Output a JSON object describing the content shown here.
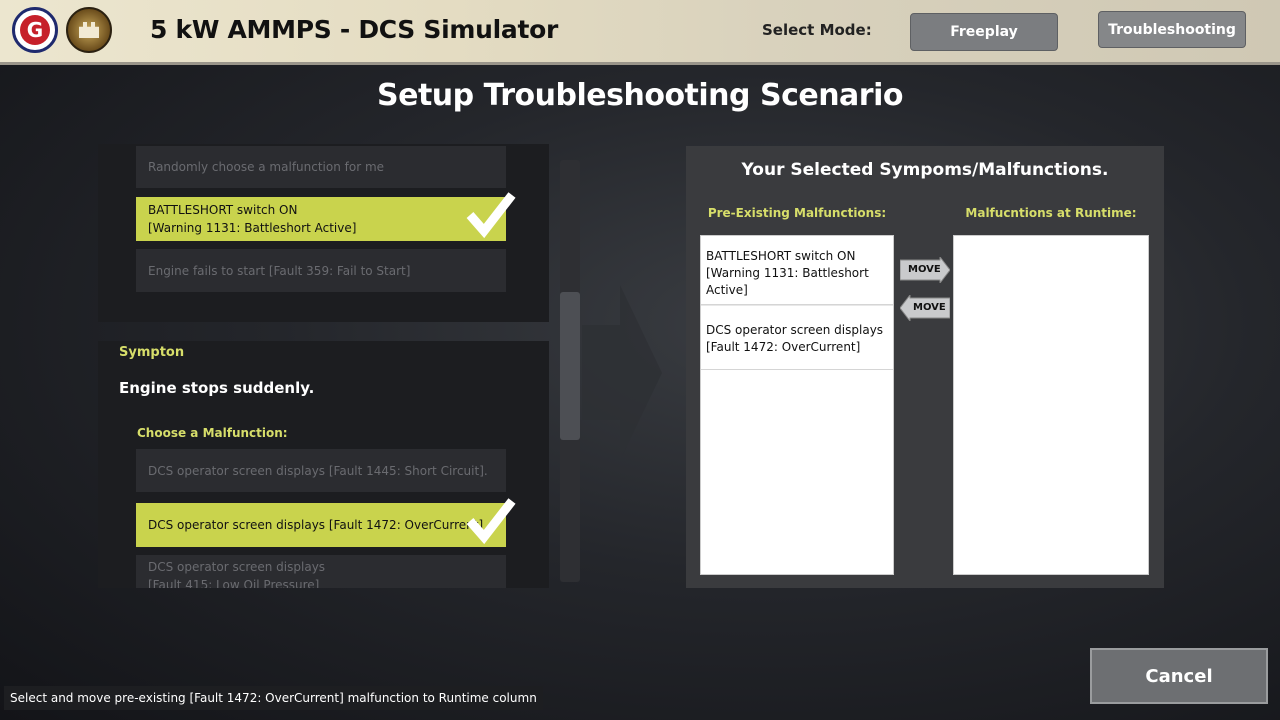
{
  "header": {
    "title": "5 kW AMMPS - DCS Simulator",
    "logo_left": {
      "glyph": "G",
      "icon": "g-emblem-logo",
      "color": "#c6202a"
    },
    "logo_right": {
      "icon": "castle-emblem-logo"
    },
    "select_mode_label": "Select Mode:",
    "modes": [
      {
        "label": "Freeplay",
        "active": false
      },
      {
        "label": "Troubleshooting",
        "active": true
      }
    ]
  },
  "page_title": "Setup Troubleshooting Scenario",
  "top_options": [
    {
      "text": "Randomly choose a malfunction for me",
      "selected": false
    },
    {
      "text": "BATTLESHORT switch ON\n[Warning 1131: Battleshort Active]",
      "line1": "BATTLESHORT switch ON",
      "line2": "[Warning 1131: Battleshort Active]",
      "selected": true
    },
    {
      "text": "Engine fails to start [Fault 359: Fail to Start]",
      "selected": false
    }
  ],
  "symptom": {
    "label": "Sympton",
    "text": "Engine stops suddenly.",
    "choose_label": "Choose a Malfunction:",
    "options": [
      {
        "text": "DCS operator screen displays [Fault 1445: Short Circuit].",
        "selected": false
      },
      {
        "text": "DCS operator screen displays [Fault 1472: OverCurrent]",
        "selected": true
      },
      {
        "line1": "DCS operator screen displays",
        "line2": "[Fault 415: Low Oil Pressure]",
        "selected": false
      }
    ]
  },
  "selected_panel": {
    "title": "Your Selected Sympoms/Malfunctions.",
    "pre_existing_label": "Pre-Existing Malfunctions:",
    "runtime_label": "Malfucntions at Runtime:",
    "pre_existing_items": [
      {
        "line1": "BATTLESHORT switch ON",
        "line2": "[Warning 1131: Battleshort",
        "line3": "Active]"
      },
      {
        "line1": "DCS operator screen displays",
        "line2": "[Fault 1472: OverCurrent]"
      }
    ],
    "runtime_items": [],
    "move_right_label": "MOVE",
    "move_left_label": "MOVE"
  },
  "cancel_label": "Cancel",
  "status_text": "Select and move pre-existing [Fault 1472: OverCurrent] malfunction to Runtime column",
  "colors": {
    "accent": "#c9d34d",
    "accent_text": "#d7de6a",
    "dim_option": "#2b2c30",
    "button_gray": "#7b7d80"
  }
}
